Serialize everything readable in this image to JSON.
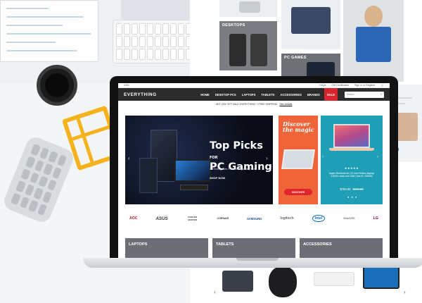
{
  "right_page": {
    "tiles": [
      {
        "label": ""
      },
      {
        "label": "DESKTOPS"
      },
      {
        "label": "PC GAMES"
      }
    ]
  },
  "store": {
    "util_bar": {
      "left": "USD",
      "faqs": "FAQs",
      "gift": "Gift Certificates",
      "signin": "Sign in or Register"
    },
    "logo": "EVERYTHING",
    "menu": [
      "HOME",
      "DESKTOP PCS",
      "LAPTOPS",
      "TABLETS",
      "ACCESSORIES",
      "BRANDS",
      "SALE"
    ],
    "search_placeholder": "Search",
    "promo": {
      "text": "GET 20% OFF SALE EVERYTHING + FREE SHIPPING",
      "link": "See Details"
    },
    "hero": {
      "title_line1": "Top Picks",
      "title_for": "FOR",
      "title_line2": "PC Gaming",
      "subtitle": "Get three games FREE when you buy PCs",
      "cta": "SHOP NOW"
    },
    "promo_card": {
      "title": "Discover the magic",
      "button": "DISCOVER"
    },
    "product_card": {
      "stars": "★★★★★",
      "description": "Apple MacBook Air (13-inch Retina display, 1.6GHz dual-core Intel Core i5, 128GB)",
      "price": "$769.00",
      "old_price": "$699.00",
      "dots": "● ● ●"
    },
    "brands": [
      "AOC",
      "ASUS",
      "COOLER MASTER",
      "CORSAIR",
      "SAMSUNG",
      "logitech",
      "intel",
      "SEAGATE",
      "LG"
    ],
    "categories": [
      "LAPTOPS",
      "TABLETS",
      "ACCESSORIES"
    ]
  },
  "colors": {
    "nav_bg": "#2b2b2b",
    "sale_red": "#d7262e",
    "promo_orange": "#f0643a",
    "product_teal": "#1f9fb5"
  }
}
